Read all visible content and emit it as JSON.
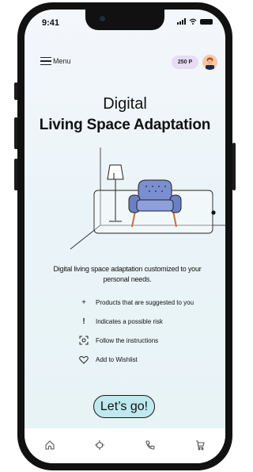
{
  "status": {
    "time": "9:41"
  },
  "header": {
    "menu_label": "Menu",
    "points": "250 P"
  },
  "hero": {
    "title_line1": "Digital",
    "title_line2": "Living Space Adaptation"
  },
  "description": "Digital living space adaptation customized to your personal needs.",
  "features": [
    {
      "icon": "plus-icon",
      "label": "Products that are suggested to you"
    },
    {
      "icon": "exclamation-icon",
      "label": "Indicates a possible risk"
    },
    {
      "icon": "scan-icon",
      "label": "Follow the instructions"
    },
    {
      "icon": "heart-icon",
      "label": "Add to Wishlist"
    }
  ],
  "cta": {
    "label": "Let’s go!"
  },
  "tabbar": [
    "home-icon",
    "ar-cube-icon",
    "phone-icon",
    "cart-icon"
  ],
  "colors": {
    "accent": "#bfe8ef",
    "badge": "#e6dcf3",
    "chair": "#7a8fd0"
  }
}
